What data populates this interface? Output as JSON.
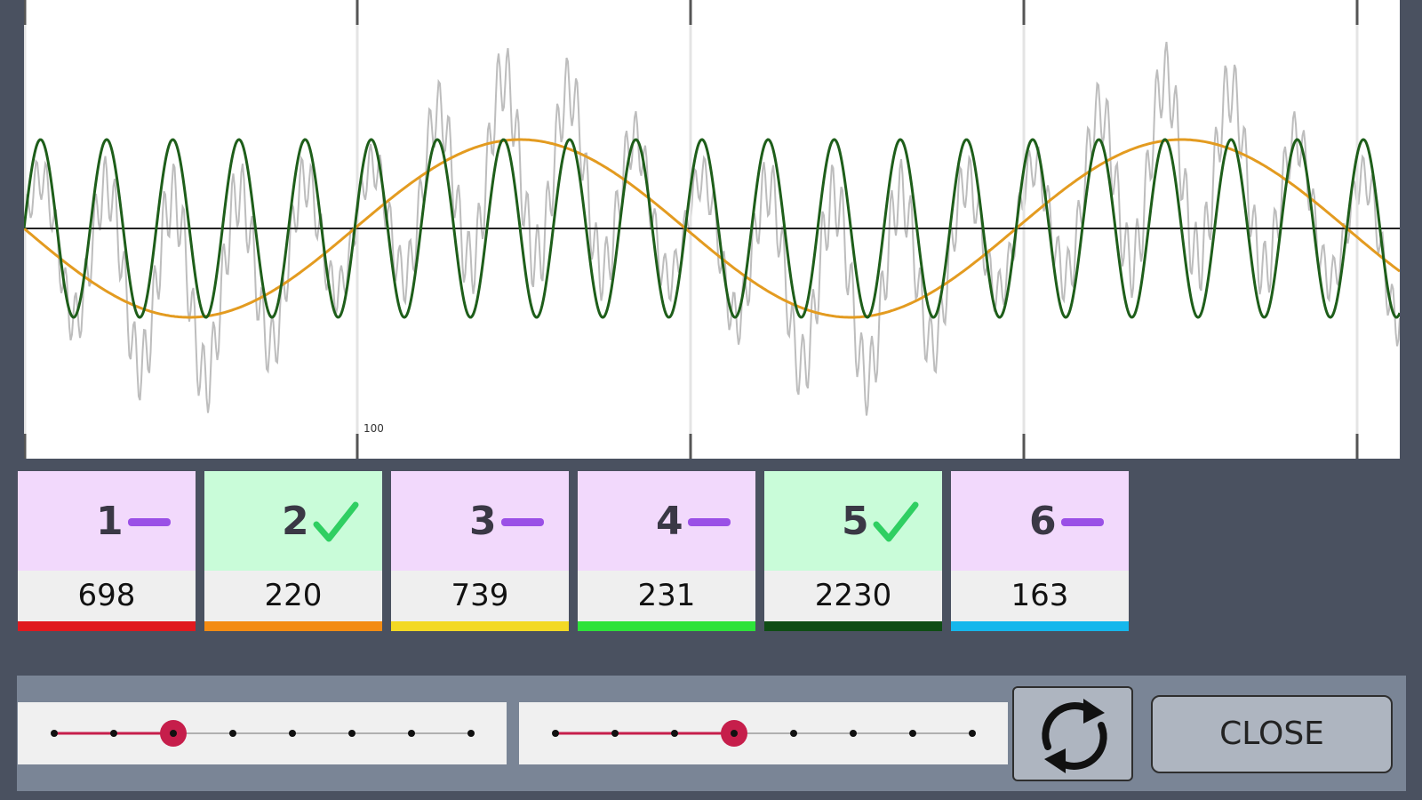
{
  "plot": {
    "axis_marker_label": "100",
    "sine_slow": {
      "color": "#e39b20",
      "cycles": 2.08,
      "amplitude": 1,
      "phase_start": "descending"
    },
    "sine_fast": {
      "color": "#1e5e1a",
      "cycles": 20.8,
      "amplitude": 1
    },
    "composite_color": "#bdbdbd",
    "axis_color": "#222222",
    "marker_color": "#555555"
  },
  "chips": [
    {
      "number": "1",
      "state": "inactive",
      "icon": "dash-icon",
      "value": "698",
      "bar_color": "#e0191f"
    },
    {
      "number": "2",
      "state": "active",
      "icon": "checkmark-icon",
      "value": "220",
      "bar_color": "#f38b13"
    },
    {
      "number": "3",
      "state": "inactive",
      "icon": "dash-icon",
      "value": "739",
      "bar_color": "#f3d925"
    },
    {
      "number": "4",
      "state": "inactive",
      "icon": "dash-icon",
      "value": "231",
      "bar_color": "#2ee23a"
    },
    {
      "number": "5",
      "state": "active",
      "icon": "checkmark-icon",
      "value": "2230",
      "bar_color": "#0f4c15"
    },
    {
      "number": "6",
      "state": "inactive",
      "icon": "dash-icon",
      "value": "163",
      "bar_color": "#16b7ec"
    }
  ],
  "chip_colors": {
    "active_bg": "#c9fcd9",
    "inactive_bg": "#f2d9fc",
    "checkmark": "#2fcf62",
    "dash": "#9a50e6"
  },
  "sliders": [
    {
      "stops": 8,
      "selected_index": 2
    },
    {
      "stops": 8,
      "selected_index": 3
    }
  ],
  "slider_colors": {
    "active": "#c61e4b",
    "inactive": "#b0b0b0",
    "dot": "#111111"
  },
  "buttons": {
    "refresh_icon": "refresh-icon",
    "close_label": "CLOSE"
  }
}
